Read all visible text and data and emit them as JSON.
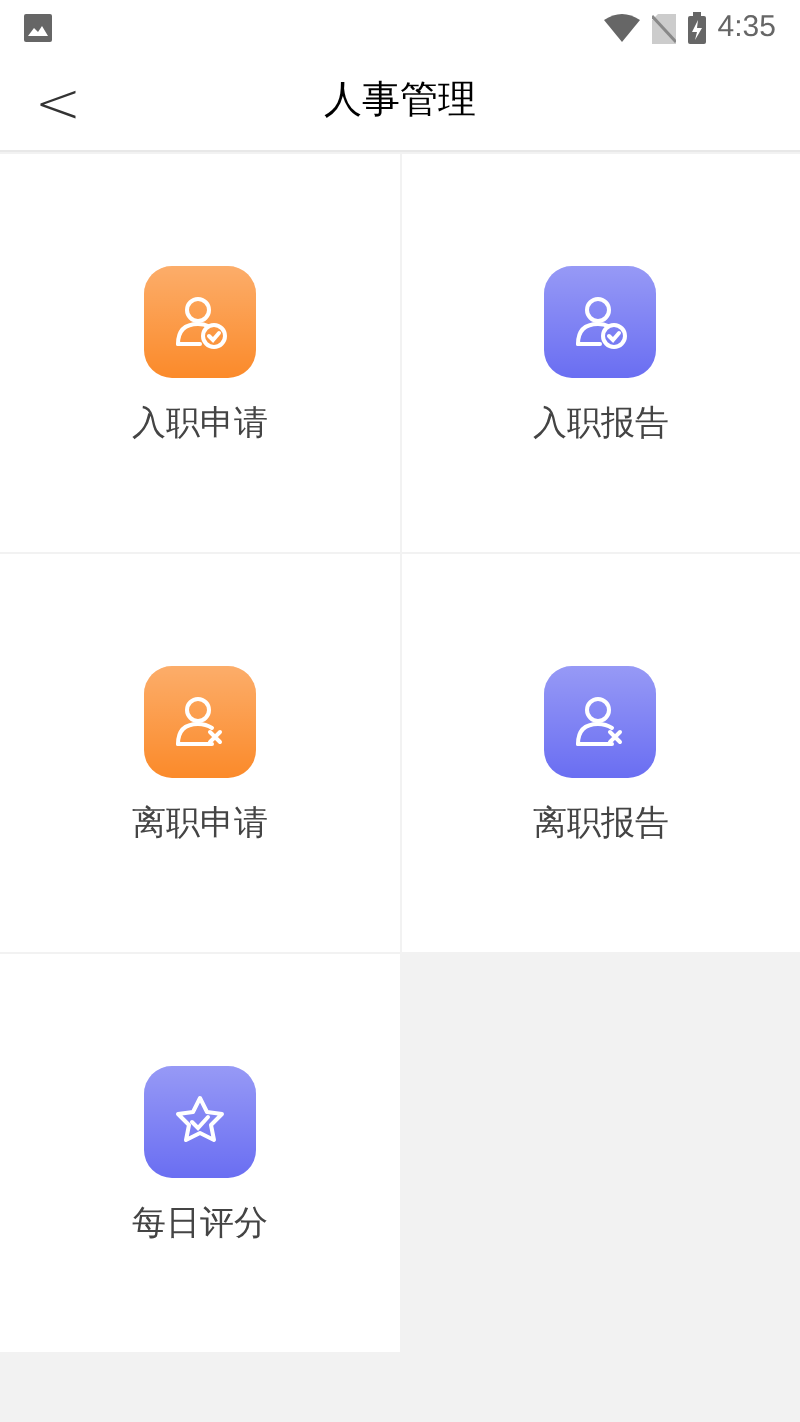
{
  "status_bar": {
    "time": "4:35"
  },
  "header": {
    "back": "<",
    "title": "人事管理"
  },
  "tiles": [
    {
      "label": "入职申请",
      "kind": "join",
      "color": "#fb8a2a"
    },
    {
      "label": "入职报告",
      "kind": "join",
      "color": "#6a6ef2"
    },
    {
      "label": "离职申请",
      "kind": "leave",
      "color": "#fb8a2a"
    },
    {
      "label": "离职报告",
      "kind": "leave",
      "color": "#6a6ef2"
    },
    {
      "label": "每日评分",
      "kind": "rating",
      "color": "#6a6ef2"
    }
  ]
}
